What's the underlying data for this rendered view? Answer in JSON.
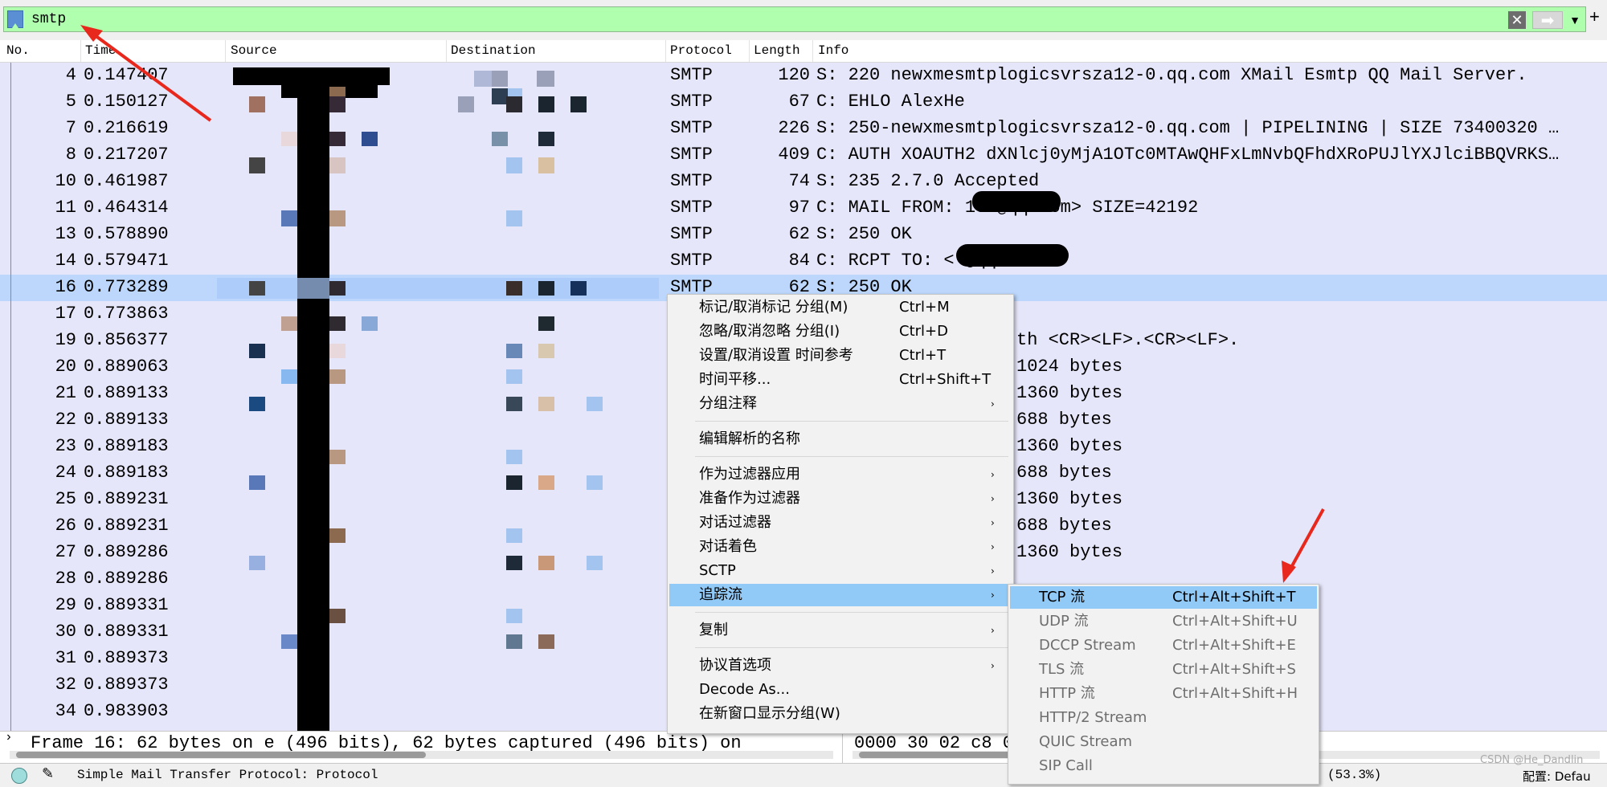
{
  "filter": {
    "text": "smtp",
    "bg_color": "#afffaf"
  },
  "columns": {
    "no": "No.",
    "time": "Time",
    "source": "Source",
    "destination": "Destination",
    "protocol": "Protocol",
    "length": "Length",
    "info": "Info"
  },
  "packets": [
    {
      "no": "4",
      "time": "0.147407",
      "proto": "SMTP",
      "len": "120",
      "info": "S: 220 newxmesmtplogicsvrsza12-0.qq.com XMail Esmtp QQ Mail Server."
    },
    {
      "no": "5",
      "time": "0.150127",
      "proto": "SMTP",
      "len": "67",
      "info": "C: EHLO AlexHe"
    },
    {
      "no": "7",
      "time": "0.216619",
      "proto": "SMTP",
      "len": "226",
      "info": "S: 250-newxmesmtplogicsvrsza12-0.qq.com | PIPELINING | SIZE 73400320 …"
    },
    {
      "no": "8",
      "time": "0.217207",
      "proto": "SMTP",
      "len": "409",
      "info": "C: AUTH XOAUTH2 dXNlcj0yMjA1OTc0MTAwQHFxLmNvbQFhdXRoPUJlYXJlciBBQVRKS…"
    },
    {
      "no": "10",
      "time": "0.461987",
      "proto": "SMTP",
      "len": "74",
      "info": "S: 235 2.7.0 Accepted"
    },
    {
      "no": "11",
      "time": "0.464314",
      "proto": "SMTP",
      "len": "97",
      "info": "C: MAIL FROM:           100@qq.com> SIZE=42192"
    },
    {
      "no": "13",
      "time": "0.578890",
      "proto": "SMTP",
      "len": "62",
      "info": "S: 250 OK"
    },
    {
      "no": "14",
      "time": "0.579471",
      "proto": "SMTP",
      "len": "84",
      "info": "C: RCPT TO: <            @qq.com>"
    },
    {
      "no": "16",
      "time": "0.773289",
      "proto": "SMTP",
      "len": "62",
      "info": "S: 250 OK"
    },
    {
      "no": "17",
      "time": "0.773863",
      "proto": "",
      "len": "",
      "info": ""
    },
    {
      "no": "19",
      "time": "0.856377",
      "proto": "",
      "len": "",
      "info": "th <CR><LF>.<CR><LF>."
    },
    {
      "no": "20",
      "time": "0.889063",
      "proto": "",
      "len": "",
      "info": "1024 bytes"
    },
    {
      "no": "21",
      "time": "0.889133",
      "proto": "",
      "len": "",
      "info": "1360 bytes"
    },
    {
      "no": "22",
      "time": "0.889133",
      "proto": "",
      "len": "",
      "info": "688 bytes"
    },
    {
      "no": "23",
      "time": "0.889183",
      "proto": "",
      "len": "",
      "info": "1360 bytes"
    },
    {
      "no": "24",
      "time": "0.889183",
      "proto": "",
      "len": "",
      "info": "688 bytes"
    },
    {
      "no": "25",
      "time": "0.889231",
      "proto": "",
      "len": "",
      "info": "1360 bytes"
    },
    {
      "no": "26",
      "time": "0.889231",
      "proto": "",
      "len": "",
      "info": "688 bytes"
    },
    {
      "no": "27",
      "time": "0.889286",
      "proto": "",
      "len": "",
      "info": "1360 bytes"
    },
    {
      "no": "28",
      "time": "0.889286",
      "proto": "",
      "len": "",
      "info": "688 bytes"
    },
    {
      "no": "29",
      "time": "0.889331",
      "proto": "",
      "len": "",
      "info": ""
    },
    {
      "no": "30",
      "time": "0.889331",
      "proto": "",
      "len": "",
      "info": ""
    },
    {
      "no": "31",
      "time": "0.889373",
      "proto": "",
      "len": "",
      "info": ""
    },
    {
      "no": "32",
      "time": "0.889373",
      "proto": "",
      "len": "",
      "info": ""
    },
    {
      "no": "34",
      "time": "0.983903",
      "proto": "",
      "len": "",
      "info": ""
    }
  ],
  "context_menu": {
    "items": [
      {
        "label": "标记/取消标记 分组(M)",
        "shortcut": "Ctrl+M"
      },
      {
        "label": "忽略/取消忽略 分组(I)",
        "shortcut": "Ctrl+D"
      },
      {
        "label": "设置/取消设置 时间参考",
        "shortcut": "Ctrl+T"
      },
      {
        "label": "时间平移...",
        "shortcut": "Ctrl+Shift+T"
      },
      {
        "label": "分组注释",
        "shortcut": ""
      },
      {
        "label": "编辑解析的名称",
        "shortcut": ""
      },
      {
        "label": "作为过滤器应用",
        "shortcut": ""
      },
      {
        "label": "准备作为过滤器",
        "shortcut": ""
      },
      {
        "label": "对话过滤器",
        "shortcut": ""
      },
      {
        "label": "对话着色",
        "shortcut": ""
      },
      {
        "label": "SCTP",
        "shortcut": ""
      },
      {
        "label": "追踪流",
        "shortcut": ""
      },
      {
        "label": "复制",
        "shortcut": ""
      },
      {
        "label": "协议首选项",
        "shortcut": ""
      },
      {
        "label": "Decode As...",
        "shortcut": ""
      },
      {
        "label": "在新窗口显示分组(W)",
        "shortcut": ""
      }
    ]
  },
  "follow_submenu": {
    "items": [
      {
        "label": "TCP 流",
        "shortcut": "Ctrl+Alt+Shift+T"
      },
      {
        "label": "UDP 流",
        "shortcut": "Ctrl+Alt+Shift+U"
      },
      {
        "label": "DCCP Stream",
        "shortcut": "Ctrl+Alt+Shift+E"
      },
      {
        "label": "TLS 流",
        "shortcut": "Ctrl+Alt+Shift+S"
      },
      {
        "label": "HTTP 流",
        "shortcut": "Ctrl+Alt+Shift+H"
      },
      {
        "label": "HTTP/2 Stream",
        "shortcut": ""
      },
      {
        "label": "QUIC Stream",
        "shortcut": ""
      },
      {
        "label": "SIP Call",
        "shortcut": ""
      }
    ]
  },
  "details": {
    "frame_line": "Frame 16: 62 bytes on    e (496 bits), 62 bytes captured (496 bits) on"
  },
  "bytes": {
    "line": "0000  30 02 c8                        08 00 45 00   0   0   D"
  },
  "status": {
    "text": "Simple Mail Transfer Protocol: Protocol",
    "right_partial": "(53.3%)",
    "profile": "配置: Defau",
    "watermark": "CSDN @He_Dandlin"
  },
  "colors": {
    "row_bg": "#e6e6fa",
    "selected_row": "#bcd7fb",
    "menu_highlight": "#91c9f7",
    "annotation_arrow": "#e8281d"
  }
}
